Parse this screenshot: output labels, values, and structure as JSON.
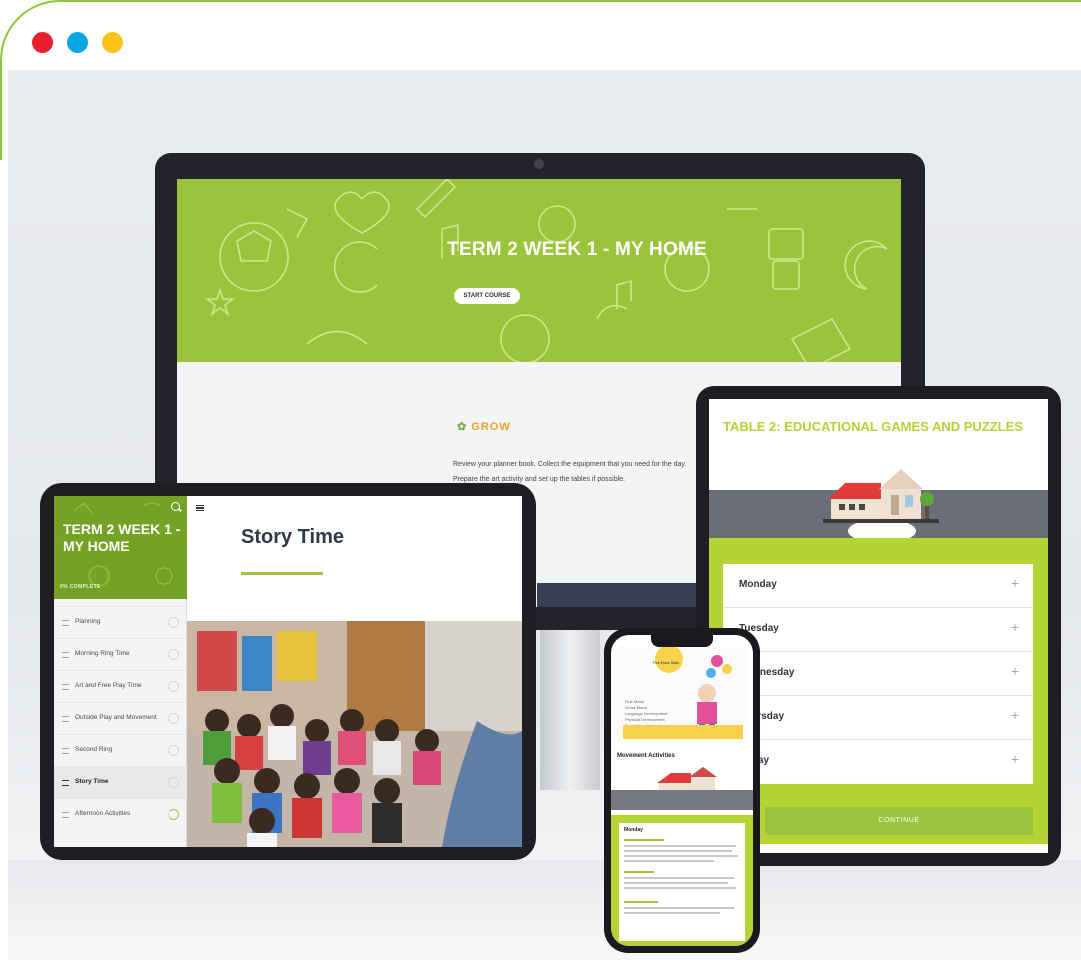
{
  "window": {
    "dots": [
      "#e8202a",
      "#0aa5e6",
      "#fcc419"
    ],
    "accent": "#8cc63f"
  },
  "monitor": {
    "hero_title": "TERM 2 WEEK 1 - MY HOME",
    "start_button": "START COURSE",
    "logo_text": "GROW",
    "body_lines": [
      "Review your planner book. Collect the equipment that you need for the day.",
      "Prepare the art activity and set up the tables if possible."
    ],
    "hero_color": "#9ac43b"
  },
  "tablet_left": {
    "sidebar_title": "TERM 2 WEEK 1 - MY HOME",
    "progress_label": "0% COMPLETE",
    "lessons": [
      {
        "label": "Planning"
      },
      {
        "label": "Morning Ring Time"
      },
      {
        "label": "Art and Free Play Time"
      },
      {
        "label": "Outside Play and Movement"
      },
      {
        "label": "Second Ring"
      },
      {
        "label": "Story Time"
      },
      {
        "label": "Afternoon Activities"
      }
    ],
    "page_title": "Story Time",
    "photo_label": "Children sitting on the floor during story time"
  },
  "tablet_right": {
    "title": "TABLE 2: EDUCATIONAL GAMES AND PUZZLES",
    "days": [
      "Monday",
      "Tuesday",
      "Wednesday",
      "Thursday",
      "Friday"
    ],
    "continue_button": "CONTINUE",
    "lime": "#b5d335"
  },
  "phone": {
    "section_title": "Movement Activities",
    "card_title": "Monday",
    "bubble_text": "Fine Motor Skills",
    "skill_lines": [
      "Fine Motor",
      "Gross Motor",
      "Language Development",
      "Physical Development",
      "Social Development"
    ]
  }
}
